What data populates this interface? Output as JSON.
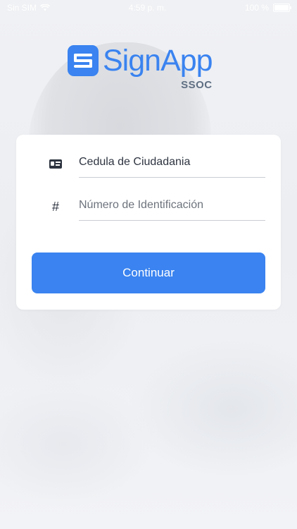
{
  "status_bar": {
    "carrier": "Sin SIM",
    "time": "4:59 p. m.",
    "battery": "100 %"
  },
  "brand": {
    "name": "SignApp",
    "subtitle": "SSOC",
    "color": "#3a83f0"
  },
  "form": {
    "document_type": {
      "icon": "id-card-icon",
      "value": "Cedula de Ciudadania"
    },
    "id_number": {
      "icon": "hash-icon",
      "placeholder": "Número de Identificación"
    },
    "submit_label": "Continuar"
  }
}
